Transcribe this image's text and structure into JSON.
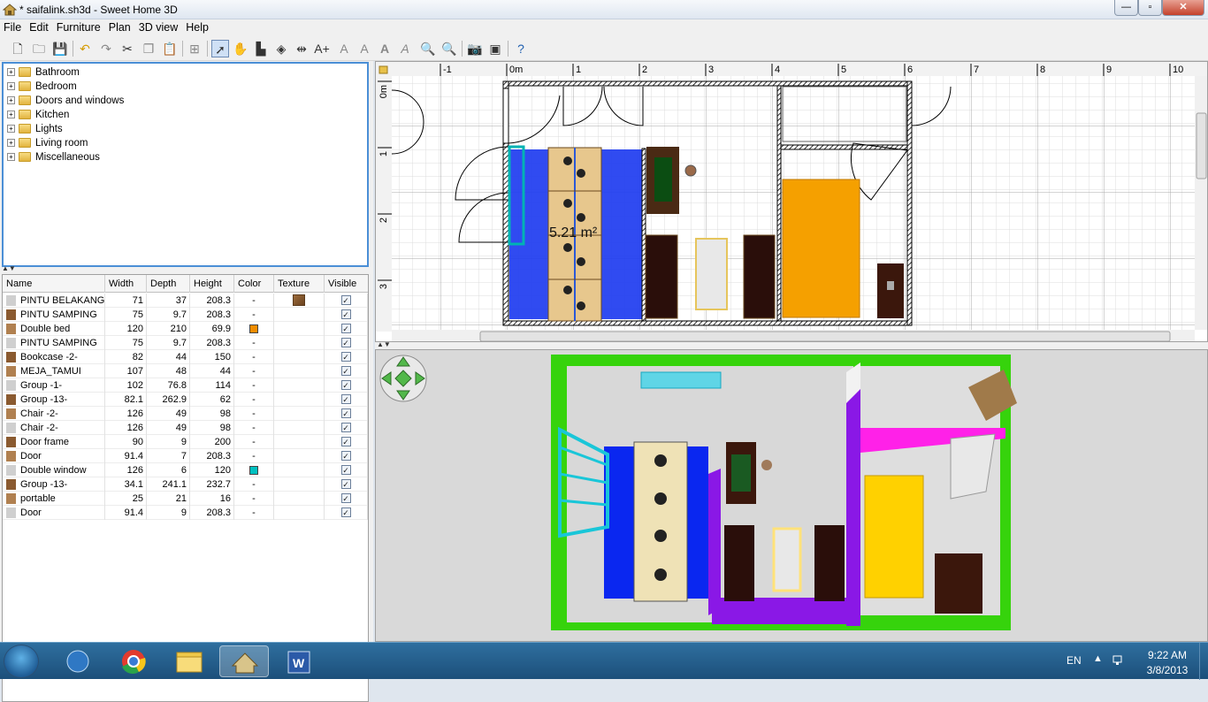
{
  "window": {
    "title": "* saifalink.sh3d - Sweet Home 3D"
  },
  "menu": [
    "File",
    "Edit",
    "Furniture",
    "Plan",
    "3D view",
    "Help"
  ],
  "toolbar_icons": [
    "new-home-icon",
    "open-icon",
    "save-icon",
    "undo-icon",
    "redo-icon",
    "cut-icon",
    "copy-icon",
    "paste-icon",
    "add-furniture-icon",
    "select-icon",
    "pan-icon",
    "create-walls-icon",
    "create-rooms-icon",
    "create-dimensions-icon",
    "add-text-icon",
    "text-style-icon",
    "bold-icon",
    "italic-icon",
    "increase-text-icon",
    "zoom-in-icon",
    "zoom-out-icon",
    "photo-icon",
    "video-icon",
    "help-icon"
  ],
  "catalog": [
    "Bathroom",
    "Bedroom",
    "Doors and windows",
    "Kitchen",
    "Lights",
    "Living room",
    "Miscellaneous"
  ],
  "table": {
    "columns": [
      "Name",
      "Width",
      "Depth",
      "Height",
      "Color",
      "Texture",
      "Visible"
    ],
    "rows": [
      {
        "name": "PINTU BELAKANG",
        "width": "71",
        "depth": "37",
        "height": "208.3",
        "color": "-",
        "texture": "wood",
        "visible": true
      },
      {
        "name": "PINTU SAMPING",
        "width": "75",
        "depth": "9.7",
        "height": "208.3",
        "color": "-",
        "texture": "",
        "visible": true
      },
      {
        "name": "Double bed",
        "width": "120",
        "depth": "210",
        "height": "69.9",
        "color": "#f08c00",
        "texture": "",
        "visible": true
      },
      {
        "name": "PINTU SAMPING",
        "width": "75",
        "depth": "9.7",
        "height": "208.3",
        "color": "-",
        "texture": "",
        "visible": true
      },
      {
        "name": "Bookcase -2-",
        "width": "82",
        "depth": "44",
        "height": "150",
        "color": "-",
        "texture": "",
        "visible": true
      },
      {
        "name": "MEJA_TAMUI",
        "width": "107",
        "depth": "48",
        "height": "44",
        "color": "-",
        "texture": "",
        "visible": true
      },
      {
        "name": "Group -1-",
        "width": "102",
        "depth": "76.8",
        "height": "114",
        "color": "-",
        "texture": "",
        "visible": true
      },
      {
        "name": "Group -13-",
        "width": "82.1",
        "depth": "262.9",
        "height": "62",
        "color": "-",
        "texture": "",
        "visible": true
      },
      {
        "name": "Chair -2-",
        "width": "126",
        "depth": "49",
        "height": "98",
        "color": "-",
        "texture": "",
        "visible": true
      },
      {
        "name": "Chair -2-",
        "width": "126",
        "depth": "49",
        "height": "98",
        "color": "-",
        "texture": "",
        "visible": true
      },
      {
        "name": "Door frame",
        "width": "90",
        "depth": "9",
        "height": "200",
        "color": "-",
        "texture": "",
        "visible": true
      },
      {
        "name": "Door",
        "width": "91.4",
        "depth": "7",
        "height": "208.3",
        "color": "-",
        "texture": "",
        "visible": true
      },
      {
        "name": "Double window",
        "width": "126",
        "depth": "6",
        "height": "120",
        "color": "#00c0c0",
        "texture": "",
        "visible": true
      },
      {
        "name": "Group -13-",
        "width": "34.1",
        "depth": "241.1",
        "height": "232.7",
        "color": "-",
        "texture": "",
        "visible": true
      },
      {
        "name": "portable",
        "width": "25",
        "depth": "21",
        "height": "16",
        "color": "-",
        "texture": "",
        "visible": true
      },
      {
        "name": "Door",
        "width": "91.4",
        "depth": "9",
        "height": "208.3",
        "color": "-",
        "texture": "",
        "visible": true
      }
    ]
  },
  "plan": {
    "ruler_x": [
      "-1",
      "0m",
      "1",
      "2",
      "3",
      "4",
      "5",
      "6",
      "7",
      "8",
      "9",
      "10"
    ],
    "ruler_y": [
      "0m",
      "1",
      "2",
      "3"
    ],
    "room_area": "5.21 m²"
  },
  "taskbar": {
    "lang": "EN",
    "time": "9:22 AM",
    "date": "3/8/2013"
  }
}
